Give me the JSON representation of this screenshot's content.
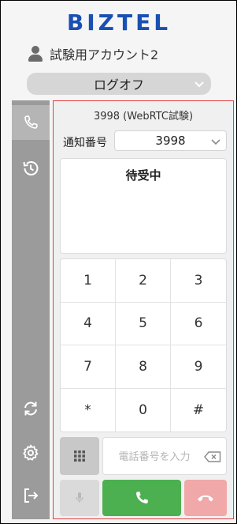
{
  "header": {
    "logo_text": "BIZTEL",
    "account_name": "試験用アカウント2",
    "logout_label": "ログオフ"
  },
  "sidebar": {
    "items": [
      {
        "icon": "phone-icon",
        "active": true
      },
      {
        "icon": "history-icon",
        "active": false
      },
      {
        "icon": "refresh-icon",
        "active": false
      },
      {
        "icon": "settings-icon",
        "active": false
      },
      {
        "icon": "sign-out-icon",
        "active": false
      }
    ]
  },
  "softphone": {
    "title": "3998 (WebRTC試験)",
    "notify_label": "通知番号",
    "notify_value": "3998",
    "status": "待受中",
    "keys": [
      "1",
      "2",
      "3",
      "4",
      "5",
      "6",
      "7",
      "8",
      "9",
      "*",
      "0",
      "#"
    ],
    "phone_input_placeholder": "電話番号を入力",
    "phone_input_value": ""
  },
  "colors": {
    "brand": "#1a4fb3",
    "sidebar": "#9b9b9b",
    "panel_border": "#e04040",
    "call": "#4caf50",
    "hangup": "#f0a8a8"
  }
}
